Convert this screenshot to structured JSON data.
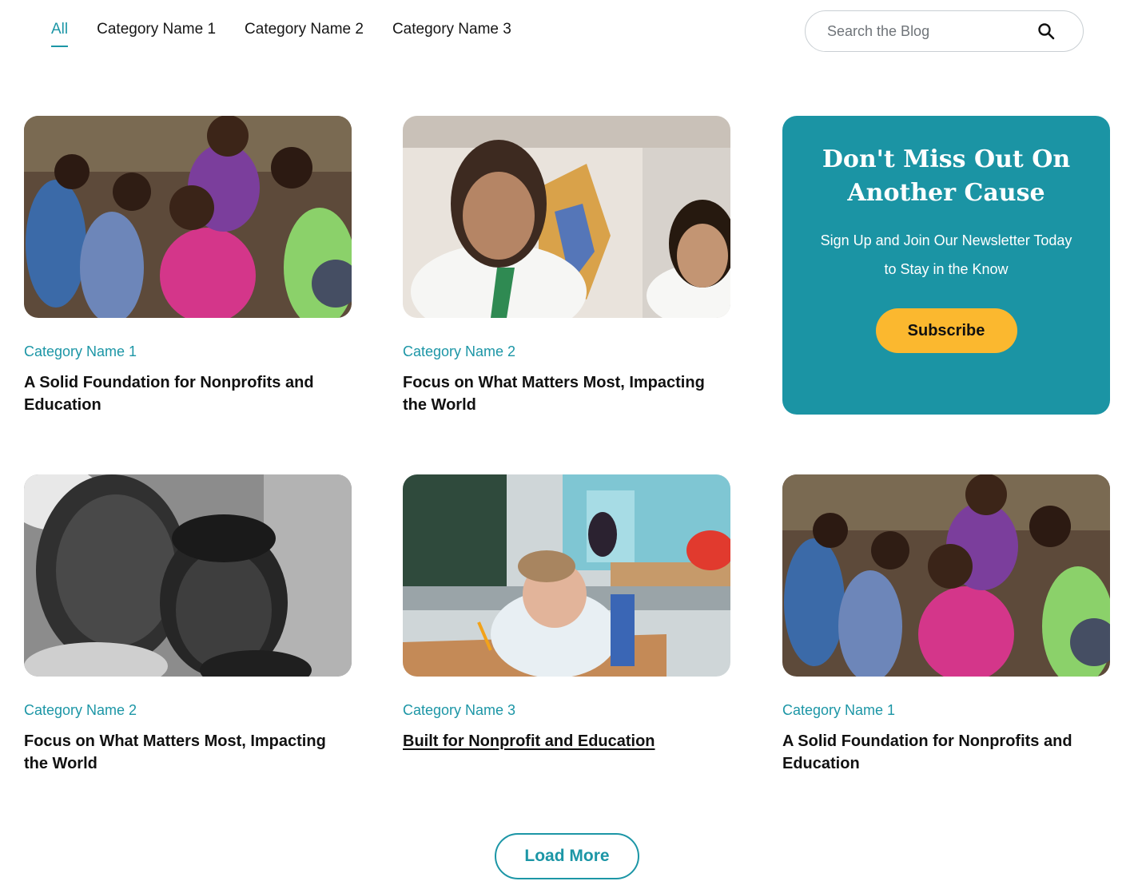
{
  "filters": {
    "tabs": [
      {
        "label": "All",
        "active": true
      },
      {
        "label": "Category Name 1",
        "active": false
      },
      {
        "label": "Category Name 2",
        "active": false
      },
      {
        "label": "Category Name 3",
        "active": false
      }
    ],
    "search_placeholder": "Search the Blog",
    "search_icon": "search-icon"
  },
  "posts": [
    {
      "category": "Category Name 1",
      "title": "A Solid Foundation for Nonprofits and Education",
      "image": "group-of-children-photo"
    },
    {
      "category": "Category Name 2",
      "title": "Focus on What Matters Most, Impacting the World",
      "image": "smiling-students-photo"
    },
    {
      "category": "Category Name 2",
      "title": "Focus on What Matters Most, Impacting the World",
      "image": "two-children-bw-photo"
    },
    {
      "category": "Category Name 3",
      "title": "Built for Nonprofit and Education",
      "image": "boy-writing-classroom-photo"
    },
    {
      "category": "Category Name 1",
      "title": "A Solid Foundation for Nonprofits and Education",
      "image": "group-of-children-photo"
    }
  ],
  "newsletter": {
    "title": "Don't Miss Out On Another Cause",
    "text": "Sign Up and Join Our Newsletter Today to Stay in the Know",
    "button": "Subscribe"
  },
  "load_more": "Load More",
  "colors": {
    "accent": "#1c96a6",
    "newsletter_bg": "#1b94a4",
    "subscribe_bg": "#fbb82f",
    "text": "#111111"
  }
}
